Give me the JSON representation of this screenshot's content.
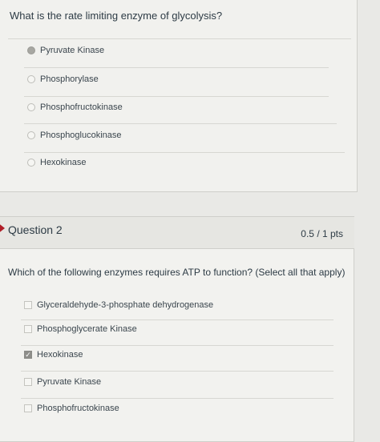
{
  "question1": {
    "text": "What is the rate limiting enzyme of glycolysis?",
    "options": [
      {
        "label": "Pyruvate Kinase",
        "selected": true
      },
      {
        "label": "Phosphorylase",
        "selected": false
      },
      {
        "label": "Phosphofructokinase",
        "selected": false
      },
      {
        "label": "Phosphoglucokinase",
        "selected": false
      },
      {
        "label": "Hexokinase",
        "selected": false
      }
    ]
  },
  "question2": {
    "title": "Question 2",
    "points": "0.5 / 1 pts",
    "text": "Which of the following enzymes requires ATP to function? (Select all that apply)",
    "options": [
      {
        "label": "Glyceraldehyde-3-phosphate dehydrogenase",
        "checked": false
      },
      {
        "label": "Phosphoglycerate Kinase",
        "checked": false
      },
      {
        "label": "Hexokinase",
        "checked": true
      },
      {
        "label": "Pyruvate Kinase",
        "checked": false
      },
      {
        "label": "Phosphofructokinase",
        "checked": false
      }
    ]
  }
}
